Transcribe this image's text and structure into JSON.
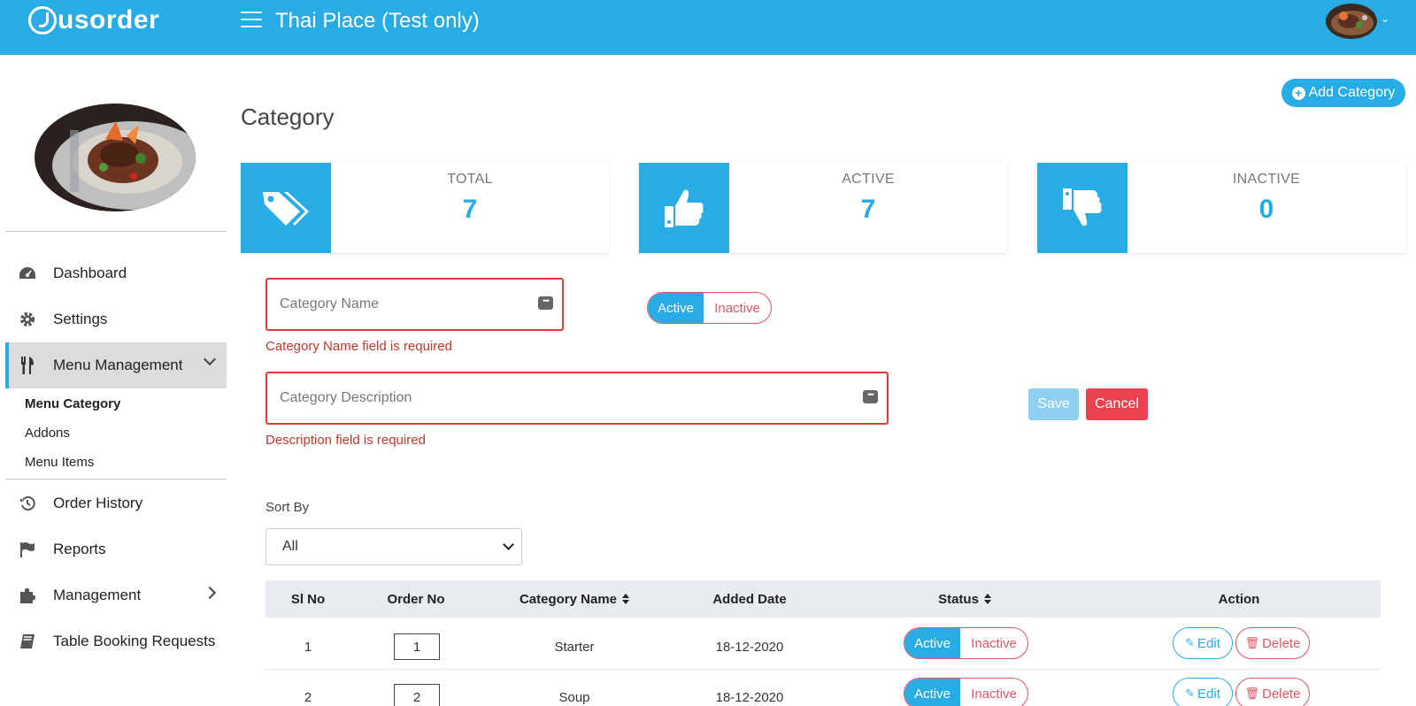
{
  "header": {
    "logo_text": "usorder",
    "title": "Thai Place (Test only)",
    "accent": "#27ace6"
  },
  "sidebar": {
    "items": [
      {
        "label": "Dashboard",
        "icon": "dashboard-icon"
      },
      {
        "label": "Settings",
        "icon": "gear-icon"
      },
      {
        "label": "Menu Management",
        "icon": "utensils-icon",
        "expanded": true
      },
      {
        "label": "Order History",
        "icon": "history-icon"
      },
      {
        "label": "Reports",
        "icon": "flag-icon"
      },
      {
        "label": "Management",
        "icon": "puzzle-icon"
      },
      {
        "label": "Table Booking Requests",
        "icon": "book-icon"
      }
    ],
    "submenu": [
      "Menu Category",
      "Addons",
      "Menu Items"
    ]
  },
  "page": {
    "title": "Category",
    "add_button": "Add Category"
  },
  "stats": [
    {
      "label": "TOTAL",
      "value": "7",
      "icon": "tags-icon"
    },
    {
      "label": "ACTIVE",
      "value": "7",
      "icon": "thumbs-up-icon"
    },
    {
      "label": "INACTIVE",
      "value": "0",
      "icon": "thumbs-down-icon"
    }
  ],
  "form": {
    "name_placeholder": "Category Name",
    "name_error": "Category Name field is required",
    "desc_placeholder": "Category Description",
    "desc_error": "Description field is required",
    "status_on": "Active",
    "status_off": "Inactive",
    "save": "Save",
    "cancel": "Cancel"
  },
  "sort": {
    "label": "Sort By",
    "selected": "All"
  },
  "table": {
    "columns": [
      "Sl No",
      "Order No",
      "Category Name",
      "Added Date",
      "Status",
      "Action"
    ],
    "rows": [
      {
        "sl": "1",
        "order": "1",
        "name": "Starter",
        "date": "18-12-2020"
      },
      {
        "sl": "2",
        "order": "2",
        "name": "Soup",
        "date": "18-12-2020"
      }
    ],
    "status_on": "Active",
    "status_off": "Inactive",
    "edit": "Edit",
    "delete": "Delete"
  }
}
